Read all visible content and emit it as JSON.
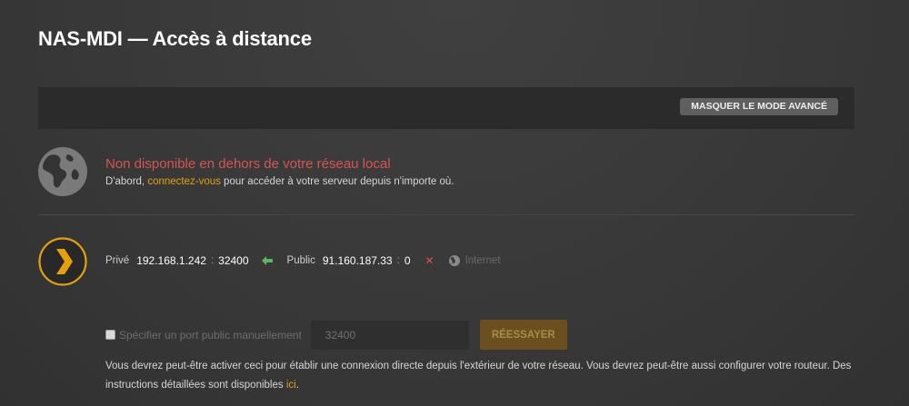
{
  "header": {
    "title": "NAS-MDI — Accès à distance"
  },
  "toolbar": {
    "advanced_mode_label": "MASQUER LE MODE AVANCÉ"
  },
  "status": {
    "title": "Non disponible en dehors de votre réseau local",
    "sub_prefix": "D'abord, ",
    "sub_link": "connectez-vous",
    "sub_suffix": " pour accéder à votre serveur depuis n'importe où."
  },
  "connection": {
    "private_label": "Privé",
    "private_ip": "192.168.1.242",
    "private_port": "32400",
    "port_separator": ":",
    "public_label": "Public",
    "public_ip": "91.160.187.33",
    "public_port": "0",
    "internet_label": "Internet"
  },
  "manual_port": {
    "checkbox_label": "Spécifier un port public manuellement",
    "input_value": "32400",
    "retry_label": "RÉESSAYER"
  },
  "help": {
    "text": "Vous devrez peut-être activer ceci pour établir une connexion directe depuis l'extérieur de votre réseau. Vous devrez peut-être aussi configurer votre routeur. Des instructions détaillées sont disponibles ",
    "link": "ici",
    "suffix": "."
  },
  "colors": {
    "accent": "#e5a00d",
    "error": "#d9534f",
    "success": "#5cb85c"
  },
  "icons": {
    "globe": "globe-icon",
    "plex": "plex-logo-icon",
    "arrow": "arrow-left-icon",
    "error": "close-icon",
    "internet": "globe-small-icon"
  }
}
